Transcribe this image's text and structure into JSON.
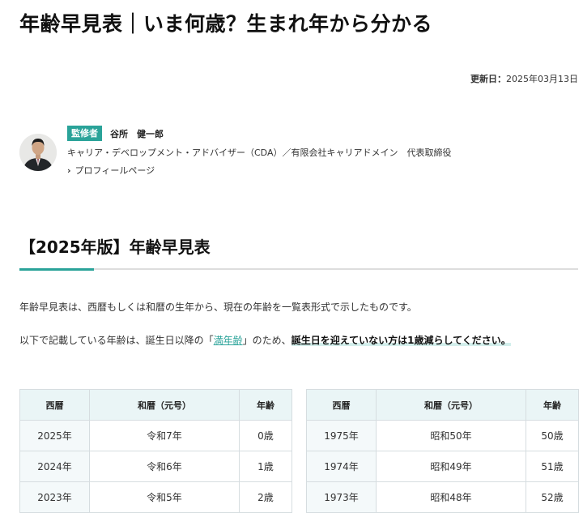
{
  "title": "年齢早見表｜いま何歳？生まれ年から分かる",
  "updated": {
    "label": "更新日：",
    "date": "2025年03月13日"
  },
  "author": {
    "badge": "監修者",
    "name": "谷所　健一郎",
    "role": "キャリア・デベロップメント・アドバイザー（CDA）／有限会社キャリアドメイン　代表取締役",
    "profile_link": "プロフィールページ",
    "avatar_icon": "person-photo-icon"
  },
  "section_title": "【2025年版】年齢早見表",
  "intro": "年齢早見表は、西暦もしくは和暦の生年から、現在の年齢を一覧表形式で示したものです。",
  "note": {
    "before": "以下で記載している年齢は、誕生日以降の「",
    "link": "満年齢",
    "middle": "」のため、",
    "emphasis": "誕生日を迎えていない方は1歳減らしてください。"
  },
  "table_headers": {
    "western": "西暦",
    "japanese": "和暦（元号）",
    "age": "年齢"
  },
  "table_left": [
    {
      "western": "2025年",
      "japanese": "令和7年",
      "age": "0歳"
    },
    {
      "western": "2024年",
      "japanese": "令和6年",
      "age": "1歳"
    },
    {
      "western": "2023年",
      "japanese": "令和5年",
      "age": "2歳"
    }
  ],
  "table_right": [
    {
      "western": "1975年",
      "japanese": "昭和50年",
      "age": "50歳"
    },
    {
      "western": "1974年",
      "japanese": "昭和49年",
      "age": "51歳"
    },
    {
      "western": "1973年",
      "japanese": "昭和48年",
      "age": "52歳"
    }
  ],
  "colors": {
    "accent": "#2aa399",
    "header_bg": "#eaf5f6",
    "border": "#d6dde0"
  }
}
